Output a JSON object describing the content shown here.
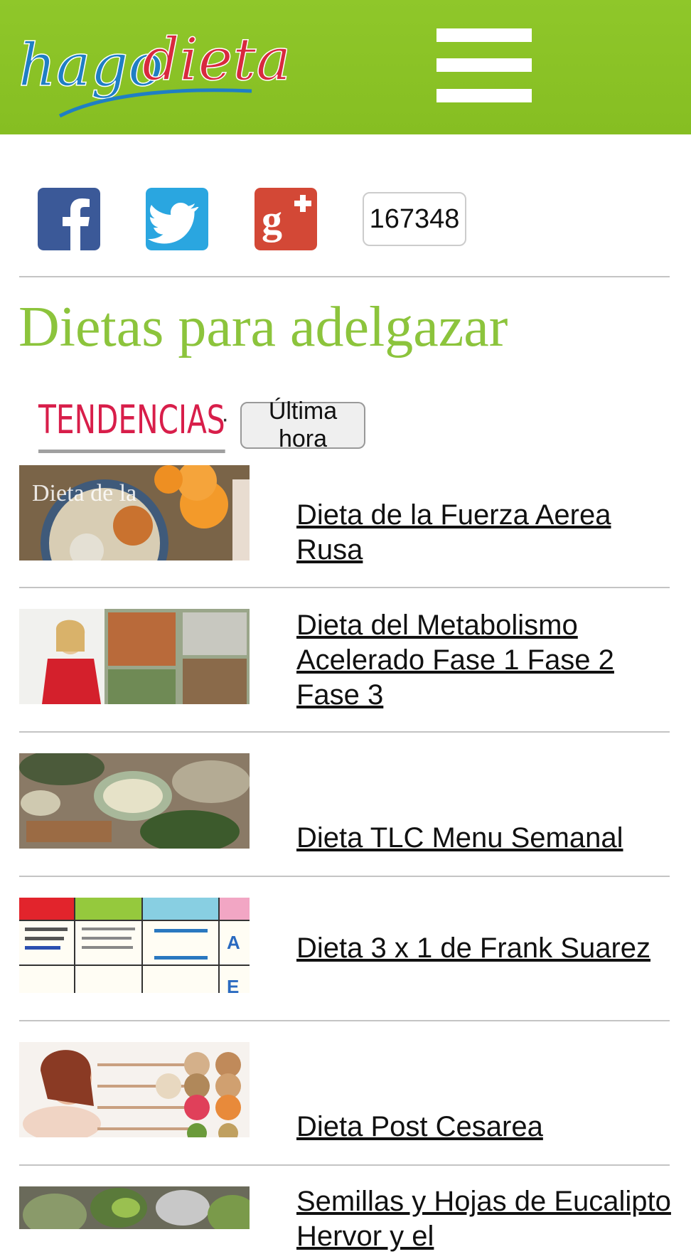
{
  "header": {
    "logo_text_blue": "hago",
    "logo_text_red": "dieta",
    "menu_icon": "hamburger-menu-icon",
    "colors": {
      "bar": "#88c024",
      "logo_blue": "#1f7fc4",
      "logo_red": "#d8293e"
    }
  },
  "social": {
    "icons": [
      "facebook-icon",
      "twitter-icon",
      "google-plus-icon"
    ],
    "share_count": "167348"
  },
  "page_title": "Dietas para adelgazar",
  "tabs": {
    "active": "TENDENCIAS",
    "separator": "·",
    "other": "Última hora"
  },
  "articles": [
    {
      "title": "Dieta de la Fuerza Aerea Rusa",
      "thumb_overlay": "Dieta de la"
    },
    {
      "title": "Dieta del Metabolismo Acelerado Fase 1 Fase 2 Fase 3"
    },
    {
      "title": "Dieta TLC Menu Semanal"
    },
    {
      "title": "Dieta 3 x 1 de Frank Suarez"
    },
    {
      "title": "Dieta Post Cesarea"
    },
    {
      "title": "Semillas y Hojas de Eucalipto Hervor y el"
    }
  ],
  "colors": {
    "title_green": "#8cc43c",
    "tab_red": "#d81e4a"
  }
}
